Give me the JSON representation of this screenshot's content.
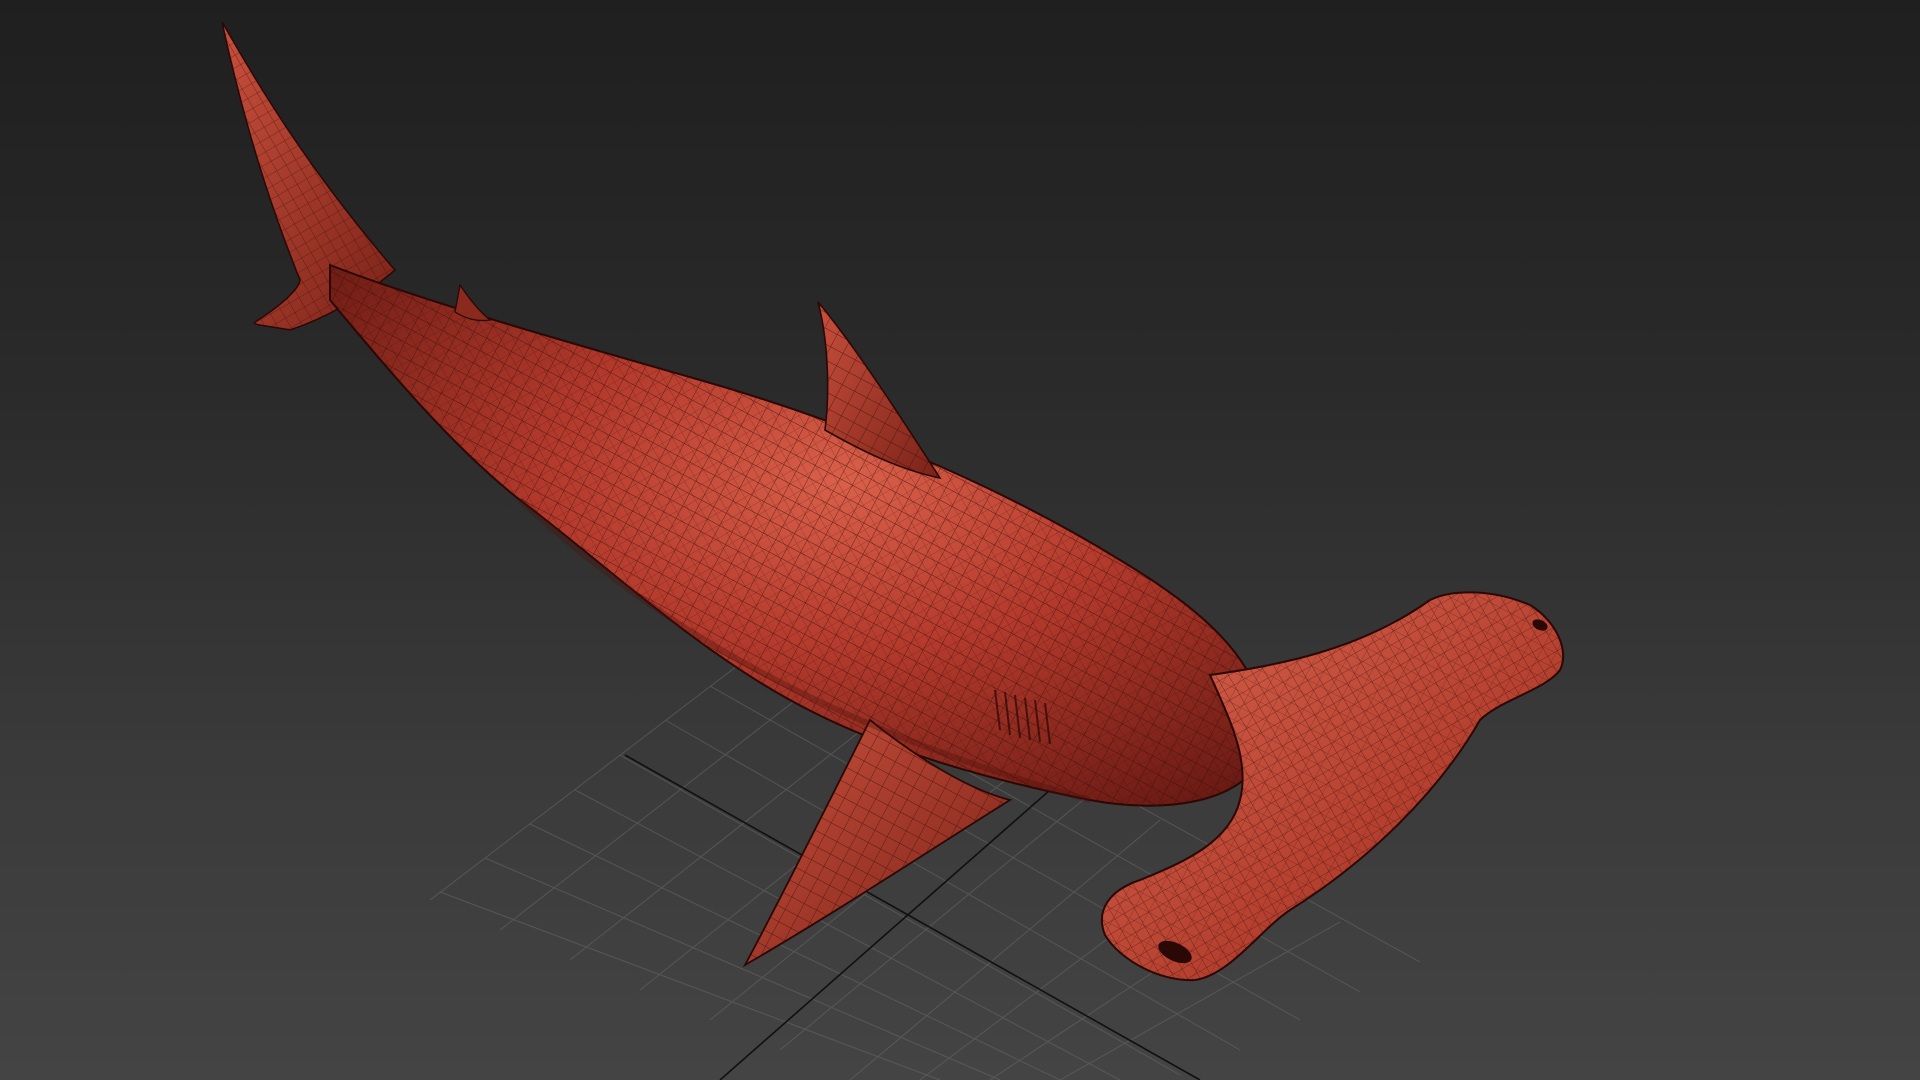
{
  "viewport": {
    "view": "perspective",
    "shading": "wireframe-over-shaded",
    "background_top": "#1f1f1f",
    "background_bottom": "#444444"
  },
  "scene": {
    "object": "hammerhead-shark-mesh",
    "mesh_color": "#b33a2c",
    "mesh_highlight": "#d9604a",
    "mesh_shadow": "#6b1b14",
    "wire_color": "#3a0c08",
    "grid_color": "#6a6a6a",
    "axis_color": "#101010"
  }
}
